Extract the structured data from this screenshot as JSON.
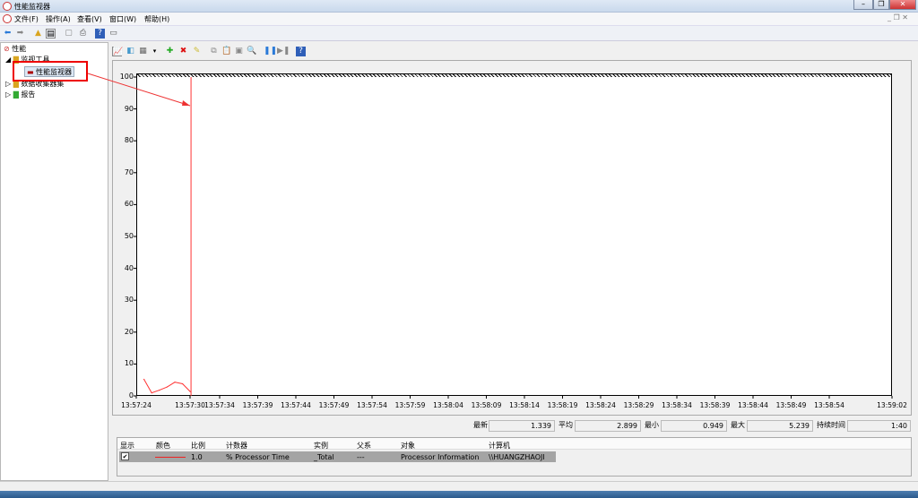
{
  "window": {
    "title": "性能监视器"
  },
  "menu": [
    "文件(F)",
    "操作(A)",
    "查看(V)",
    "窗口(W)",
    "帮助(H)"
  ],
  "tree": {
    "root": "性能",
    "monitor_tools": "监视工具",
    "perf_monitor": "性能监视器",
    "data_collector_sets": "数据收集器集",
    "reports": "报告"
  },
  "stats": {
    "last_label": "最新",
    "last": "1.339",
    "avg_label": "平均",
    "avg": "2.899",
    "min_label": "最小",
    "min": "0.949",
    "max_label": "最大",
    "max": "5.239",
    "duration_label": "持续时间",
    "duration": "1:40"
  },
  "legend": {
    "headers": [
      "显示",
      "颜色",
      "比例",
      "计数器",
      "实例",
      "父系",
      "对象",
      "计算机"
    ],
    "row": {
      "scale": "1.0",
      "counter": "% Processor Time",
      "instance": "_Total",
      "parent": "---",
      "object": "Processor Information",
      "computer": "\\\\HUANGZHAOJI"
    }
  },
  "colors": {
    "line": "#ff3333",
    "highlight": "#ee0000"
  },
  "chart_data": {
    "type": "line",
    "title": "",
    "xlabel": "",
    "ylabel": "",
    "ylim": [
      0,
      100
    ],
    "yticks": [
      "100",
      "90",
      "80",
      "70",
      "60",
      "50",
      "40",
      "30",
      "20",
      "10",
      "0"
    ],
    "xticks": [
      "13:57:24",
      "13:57:30",
      "13:57:34",
      "13:57:39",
      "13:57:44",
      "13:57:49",
      "13:57:54",
      "13:57:59",
      "13:58:04",
      "13:58:09",
      "13:58:14",
      "13:58:19",
      "13:58:24",
      "13:58:29",
      "13:58:34",
      "13:58:39",
      "13:58:44",
      "13:58:49",
      "13:58:54",
      "13:59:02"
    ],
    "series": [
      {
        "name": "% Processor Time",
        "values": [
          5.2,
          0.95,
          1.8,
          2.8,
          4.3,
          3.8,
          1.34
        ]
      }
    ],
    "sample_seconds": [
      1,
      2,
      3,
      4,
      5,
      6,
      7
    ],
    "window_seconds": 98,
    "cursor_second": 7.1
  }
}
